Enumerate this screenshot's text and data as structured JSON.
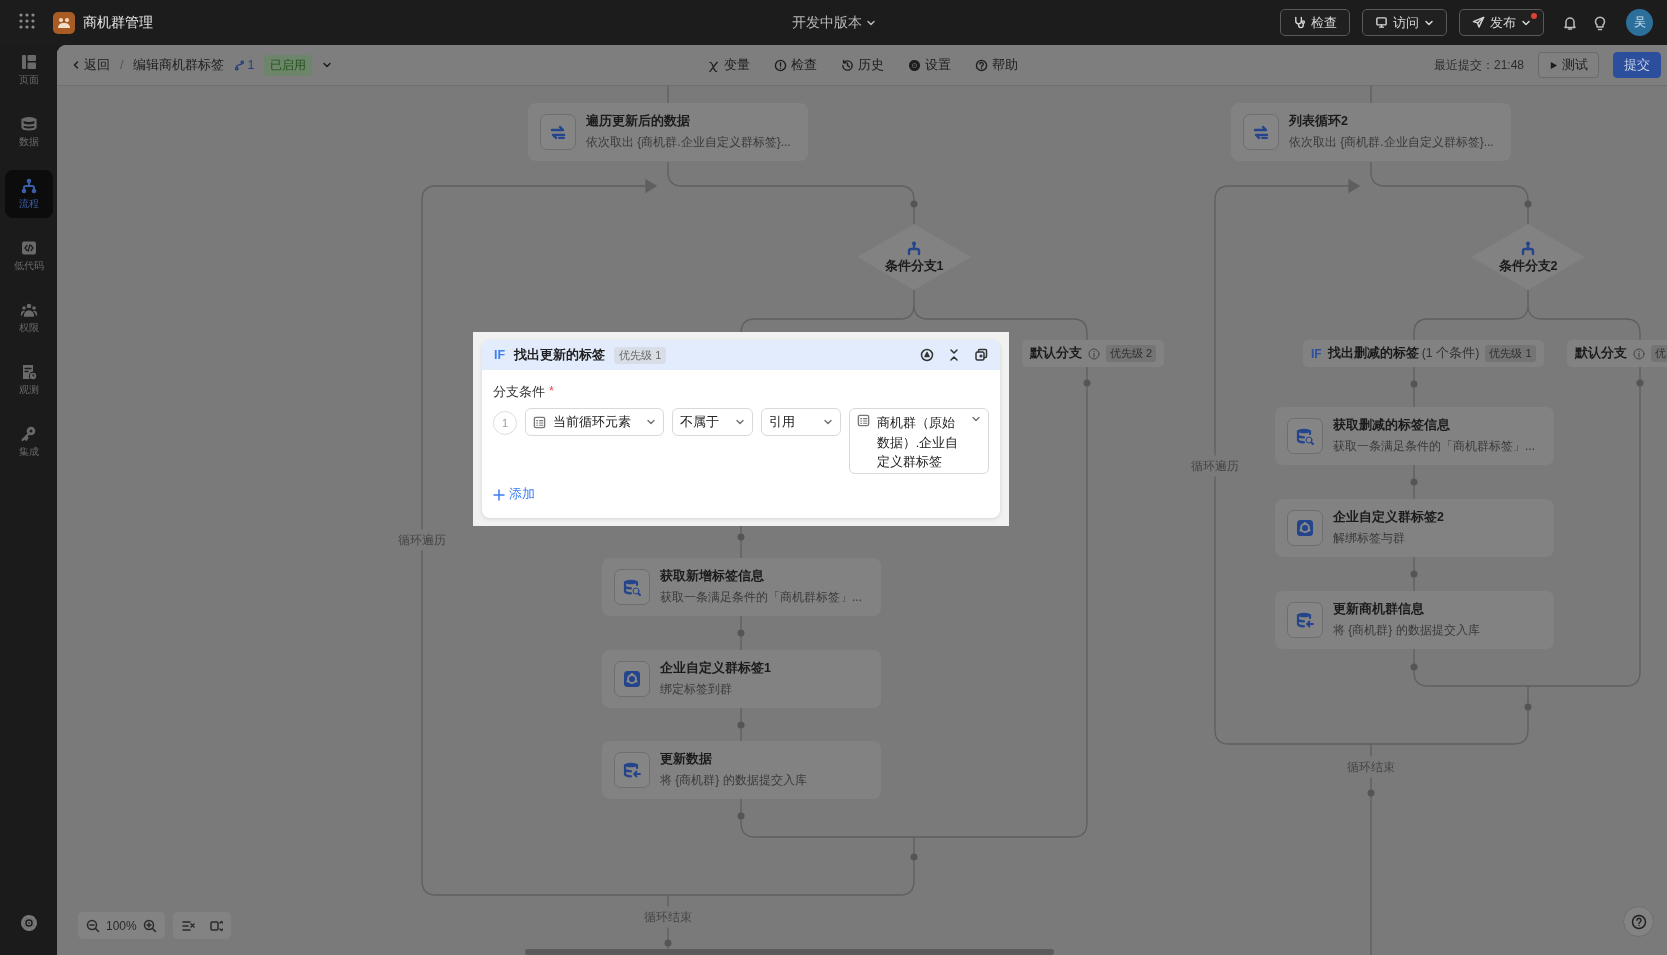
{
  "app": {
    "title": "商机群管理",
    "version": "开发中版本",
    "actions": [
      {
        "label": "检查",
        "dropdown": false,
        "badge": false
      },
      {
        "label": "访问",
        "dropdown": true,
        "badge": false
      },
      {
        "label": "发布",
        "dropdown": true,
        "badge": true
      }
    ],
    "avatar": "吴"
  },
  "sidebar": {
    "items": [
      {
        "label": "页面",
        "selected": false
      },
      {
        "label": "数据",
        "selected": false
      },
      {
        "label": "流程",
        "selected": true
      },
      {
        "label": "低代码",
        "selected": false
      },
      {
        "label": "权限",
        "selected": false
      },
      {
        "label": "观测",
        "selected": false
      },
      {
        "label": "集成",
        "selected": false
      }
    ]
  },
  "toolbar": {
    "back": "返回",
    "separator": "/",
    "breadcrumb": "编辑商机群标签",
    "version": "1",
    "status": "已启用",
    "tools": [
      {
        "label": "变量"
      },
      {
        "label": "检查"
      },
      {
        "label": "历史"
      },
      {
        "label": "设置"
      },
      {
        "label": "帮助"
      }
    ],
    "last_commit": "最近提交：21:48",
    "test": "测试",
    "submit": "提交"
  },
  "flows": [
    {
      "loop": {
        "kind": "loop",
        "title": "遍历更新后的数据",
        "subtitle": "依次取出 {商机群.企业自定义群标签}..."
      },
      "loop_label": "循环遍历",
      "end_label": "循环结束",
      "branch": {
        "title": "条件分支1"
      },
      "cases": [
        {
          "kind": "editor",
          "tag": "IF",
          "title": "找出更新的标签",
          "priority": "优先级 1",
          "field_label": "分支条件",
          "required_mark": "*",
          "conditions": [
            {
              "index": "1",
              "left": "当前循环元素",
              "operator": "不属于",
              "value_type": "引用",
              "right": "商机群（原始数据）.企业自定义群标签"
            }
          ],
          "add": "添加",
          "steps": [
            {
              "kind": "query",
              "title": "获取新增标签信息",
              "subtitle": "获取一条满足条件的「商机群标签」..."
            },
            {
              "kind": "connector",
              "title": "企业自定义群标签1",
              "subtitle": "绑定标签到群"
            },
            {
              "kind": "update",
              "title": "更新数据",
              "subtitle": "将 {商机群} 的数据提交入库"
            }
          ]
        },
        {
          "kind": "default",
          "title": "默认分支",
          "priority": "优先级 2"
        }
      ]
    },
    {
      "loop": {
        "kind": "loop",
        "title": "列表循环2",
        "subtitle": "依次取出 {商机群.企业自定义群标签}..."
      },
      "loop_label": "循环遍历",
      "end_label": "循环结束",
      "branch": {
        "title": "条件分支2"
      },
      "cases": [
        {
          "kind": "if",
          "tag": "IF",
          "title": "找出删减的标签",
          "count": "(1 个条件)",
          "priority": "优先级 1",
          "steps": [
            {
              "kind": "query",
              "title": "获取删减的标签信息",
              "subtitle": "获取一条满足条件的「商机群标签」..."
            },
            {
              "kind": "connector",
              "title": "企业自定义群标签2",
              "subtitle": "解绑标签与群"
            },
            {
              "kind": "update",
              "title": "更新商机群信息",
              "subtitle": "将 {商机群} 的数据提交入库"
            }
          ]
        },
        {
          "kind": "default",
          "title": "默认分支",
          "priority": "优"
        }
      ]
    }
  ],
  "zoom": "100%"
}
